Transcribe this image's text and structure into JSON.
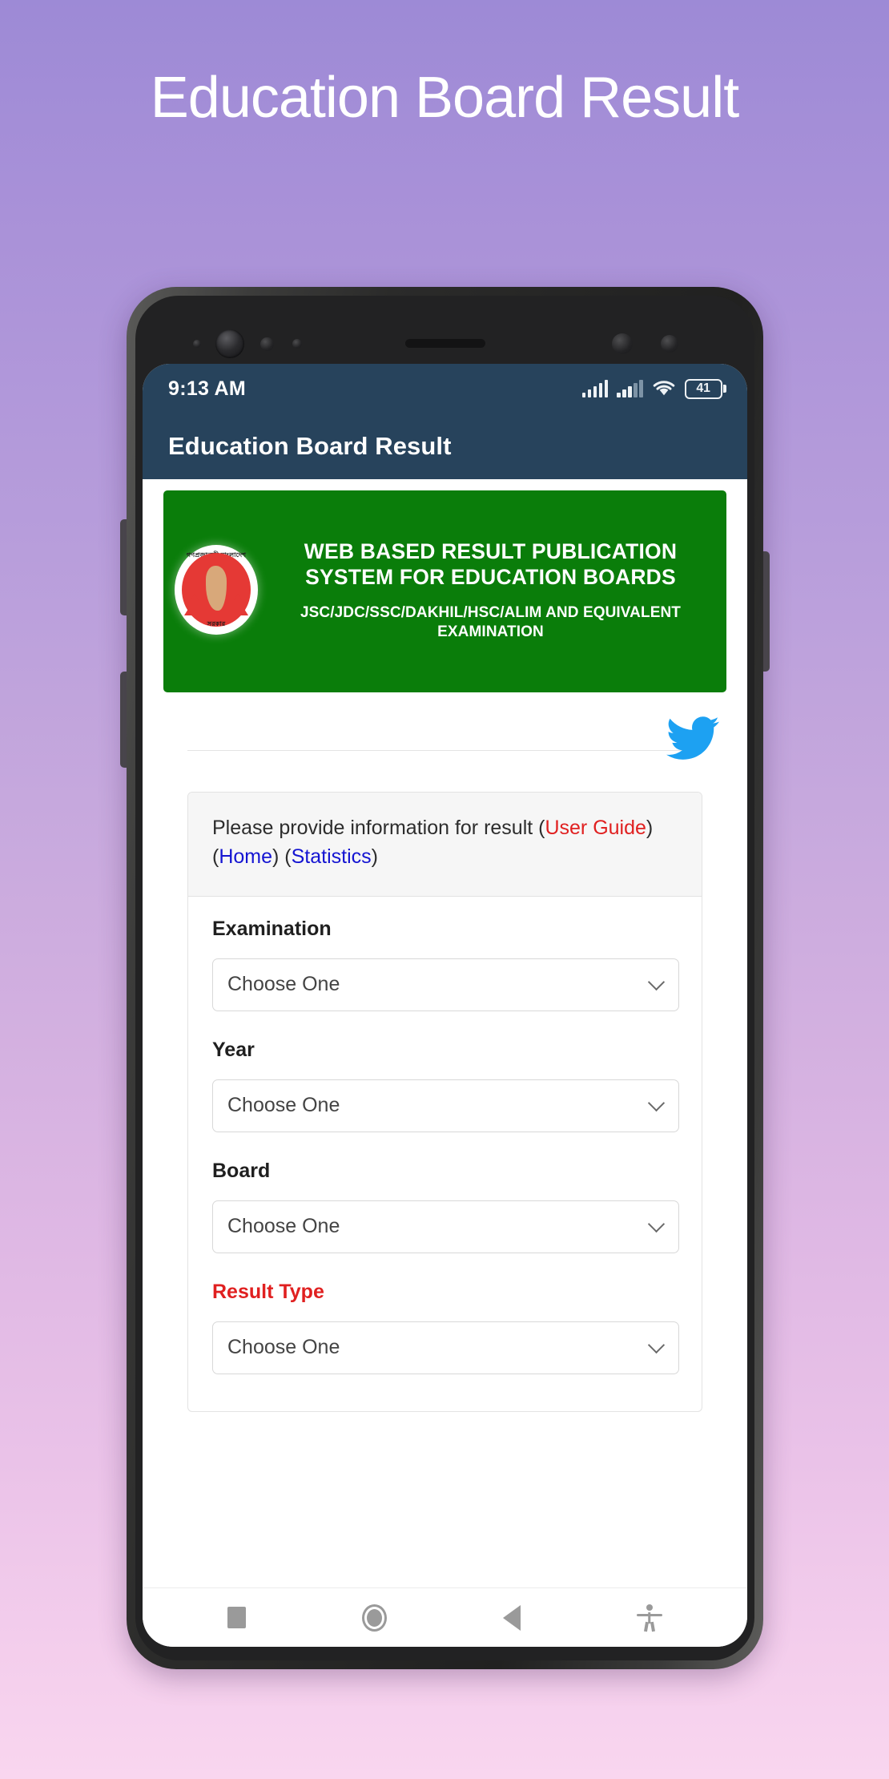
{
  "page": {
    "title": "Education Board Result",
    "background_top": "#9d8ad6",
    "background_bottom": "#f9d6ef"
  },
  "phone": {
    "status_bar": {
      "time": "9:13 AM",
      "battery_level": "41",
      "background": "#27435c",
      "icons": [
        "signal-icon",
        "signal-icon",
        "wifi-icon",
        "battery-icon"
      ]
    },
    "app_bar": {
      "title": "Education Board Result",
      "background": "#27435c"
    },
    "nav_bar": {
      "recents_label": "recents-square-icon",
      "home_label": "home-circle-icon",
      "back_label": "back-triangle-icon",
      "accessibility_label": "accessibility-icon"
    }
  },
  "web": {
    "banner": {
      "background": "#0a7d0a",
      "emblem_top_text": "গণপ্রজাতন্ত্রী  বাংলাদেশ",
      "emblem_bottom_text": "সরকার",
      "headline": "WEB BASED RESULT PUBLICATION SYSTEM FOR EDUCATION BOARDS",
      "subline": "JSC/JDC/SSC/DAKHIL/HSC/ALIM AND EQUIVALENT EXAMINATION"
    },
    "social": {
      "twitter_icon": "twitter-bird-icon",
      "twitter_color": "#1da1f2"
    },
    "notice": {
      "text_before": "Please provide information for result (",
      "user_guide_link": "User Guide",
      "between_1": ") (",
      "home_link": "Home",
      "between_2": ") (",
      "statistics_link": "Statistics",
      "text_after": ")",
      "link_red": "#e02020",
      "link_blue": "#1414d2"
    },
    "form": {
      "fields": [
        {
          "label": "Examination",
          "value": "Choose One",
          "required": false
        },
        {
          "label": "Year",
          "value": "Choose One",
          "required": false
        },
        {
          "label": "Board",
          "value": "Choose One",
          "required": false
        },
        {
          "label": "Result Type",
          "value": "Choose One",
          "required": true
        }
      ]
    }
  }
}
